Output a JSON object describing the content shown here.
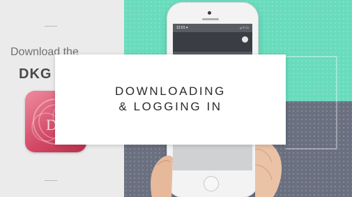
{
  "promo": {
    "line1": "Download the",
    "brand": "DKG",
    "icon_name": "dkg-app-icon",
    "icon_letters": "DK"
  },
  "phone": {
    "status_time": "12:01 ▾",
    "status_icons": "ᵢᵢᵢ ≈ ▭"
  },
  "overlay": {
    "line1": "DOWNLOADING",
    "line2": "& LOGGING IN"
  },
  "colors": {
    "teal": "#69dcbd",
    "slate": "#6a7080",
    "app_icon": "#d24865",
    "overlay_text": "#2b2b2b"
  }
}
